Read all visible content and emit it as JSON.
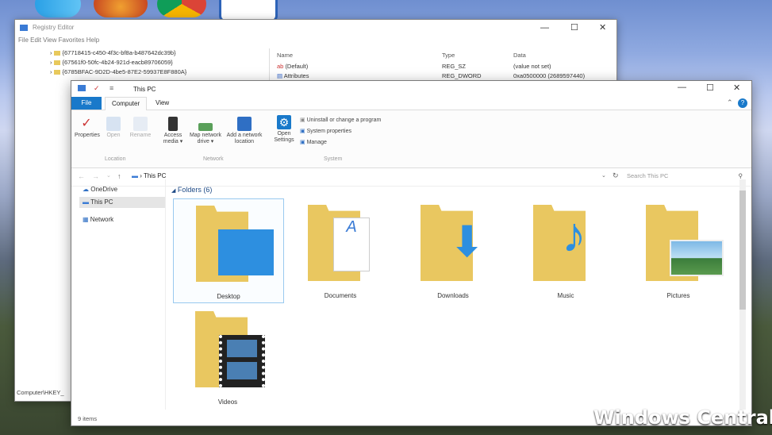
{
  "registry_editor": {
    "title": "Registry Editor",
    "menu": [
      "File",
      "Edit",
      "View",
      "Favorites",
      "Help"
    ],
    "tree_rows": [
      "{67718415-c450-4f3c-bf8a-b487642dc39b}",
      "{67561f0-50fc-4b24-921d-eacb89706059}",
      "{6785BFAC-9D2D-4be5-87E2-59937E8F880A}"
    ],
    "columns": {
      "name": "Name",
      "type": "Type",
      "data": "Data"
    },
    "values": [
      {
        "name": "(Default)",
        "type": "REG_SZ",
        "data": "(value not set)"
      },
      {
        "name": "Attributes",
        "type": "REG_DWORD",
        "data": "0xa0500000 (2689597440)"
      }
    ],
    "status": "Computer\\HKEY_"
  },
  "explorer": {
    "title": "This PC",
    "tabs": [
      "File",
      "Computer",
      "View"
    ],
    "ribbon": {
      "location": {
        "label": "Location",
        "items": [
          "Properties",
          "Open",
          "Rename"
        ]
      },
      "network": {
        "label": "Network",
        "items": [
          "Access media ▾",
          "Map network drive ▾",
          "Add a network location"
        ]
      },
      "system": {
        "label": "System",
        "open_settings": "Open Settings",
        "items": [
          "Uninstall or change a program",
          "System properties",
          "Manage"
        ]
      }
    },
    "address": {
      "path": "This PC",
      "search_placeholder": "Search This PC"
    },
    "nav": [
      "OneDrive",
      "This PC",
      "Network"
    ],
    "section_header": "Folders (6)",
    "folders": [
      "Desktop",
      "Documents",
      "Downloads",
      "Music",
      "Pictures",
      "Videos"
    ],
    "status": "9 items"
  },
  "watermark": "Windows Central",
  "colors": {
    "accent": "#1979ca",
    "folder": "#f3d672"
  }
}
